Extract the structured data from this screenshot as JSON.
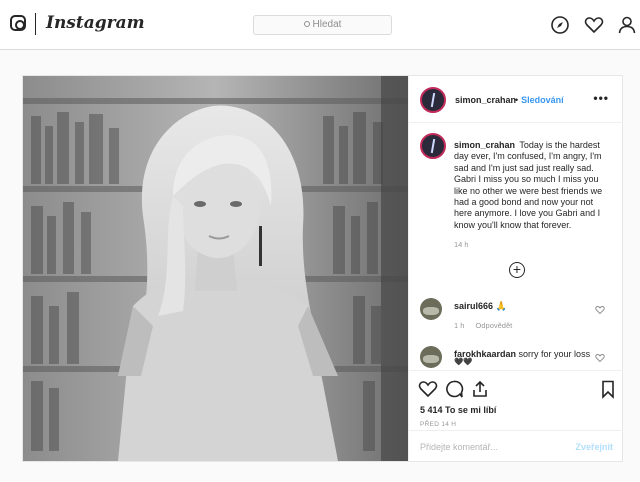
{
  "header": {
    "wordmark": "Instagram",
    "search_placeholder": "Hledat",
    "icons": [
      "instagram-logo-icon",
      "compass-icon",
      "heart-icon",
      "profile-icon"
    ]
  },
  "post": {
    "author": "simon_crahan",
    "separator": "•",
    "follow_label": "Sledování",
    "more_label": "•••",
    "caption_username": "simon_crahan",
    "caption_text": "Today is the hardest day ever, I'm confused, I'm angry, I'm sad and I'm just sad just really sad. Gabri I miss you so much I miss you like no other we were best friends we had a good bond and now your not here anymore. I love you Gabri and I know you'll know that forever.",
    "caption_time": "14 h",
    "load_more_label": "+",
    "comments": [
      {
        "username": "sairul666",
        "text": "🙏",
        "time": "1 h",
        "reply_label": "Odpovědět"
      },
      {
        "username": "farokhkaardan",
        "text": "sorry for your loss",
        "emoji": "🖤🖤"
      }
    ],
    "likes_text": "5 414 To se mi líbí",
    "timestamp": "PŘED 14 H",
    "comment_placeholder": "Přidejte komentář...",
    "post_button_label": "Zveřejnit"
  },
  "colors": {
    "accent": "#3897f0",
    "border": "#dbdbdb",
    "muted": "#999999",
    "post_disabled": "#b2dffc"
  }
}
